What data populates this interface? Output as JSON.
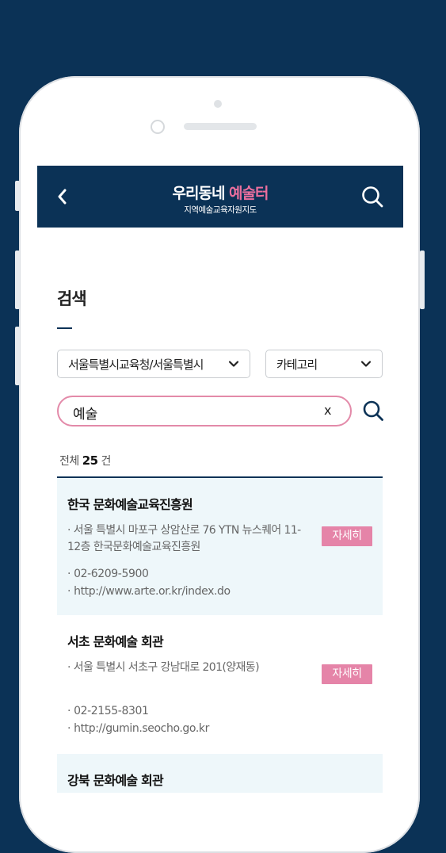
{
  "app": {
    "logo_main": "우리동네 ",
    "logo_accent": "예술터",
    "logo_sub": "지역예술교육자원지도"
  },
  "page": {
    "title": "검색"
  },
  "filters": {
    "region": "서울특별시교육청/서울특별시",
    "category": "카테고리"
  },
  "search": {
    "value": "예술",
    "clear_label": "x"
  },
  "results": {
    "total_prefix": "전체 ",
    "total_count": "25",
    "total_suffix": " 건",
    "items": [
      {
        "name": "한국 문화예술교육진흥원",
        "address": "· 서울 특별시 마포구 상암산로 76 YTN 뉴스퀘어 11-12층 한국문화예술교육진흥원",
        "phone": "· 02-6209-5900",
        "url": "· http://www.arte.or.kr/index.do",
        "detail_label": "자세히"
      },
      {
        "name": "서초 문화예술 회관",
        "address": "· 서울 특별시 서초구 강남대로 201(양재동)",
        "phone": "· 02-2155-8301",
        "url": "· http://gumin.seocho.go.kr",
        "detail_label": "자세히"
      },
      {
        "name": "강북 문화예술 회관"
      }
    ]
  },
  "colors": {
    "navy": "#0b3256",
    "pink": "#e584a8",
    "card_bg": "#eef7fa"
  },
  "icons": [
    "back-arrow-icon",
    "search-icon",
    "chevron-down-icon",
    "close-icon"
  ]
}
